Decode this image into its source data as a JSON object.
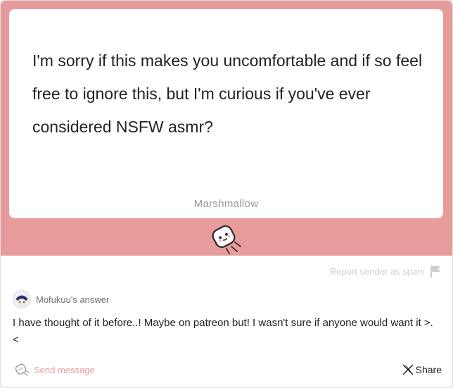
{
  "question": {
    "text": "I'm sorry if this makes you uncomfortable and if so feel free to ignore this, but I'm curious if you've ever considered NSFW asmr?",
    "brand": "Marshmallow"
  },
  "logo_icon": "marshmallow-logo-icon",
  "report": {
    "label": "Report sender as spam",
    "icon": "flag-icon"
  },
  "answer": {
    "label": "Mofukuu's answer",
    "text": "I have thought of it before..! Maybe on patreon but! I wasn't sure if anyone would want it >.<"
  },
  "footer": {
    "send_label": "Send message",
    "share_label": "Share"
  },
  "colors": {
    "accent": "#e89b9b",
    "text": "#222222",
    "muted": "#9a9a9a"
  }
}
